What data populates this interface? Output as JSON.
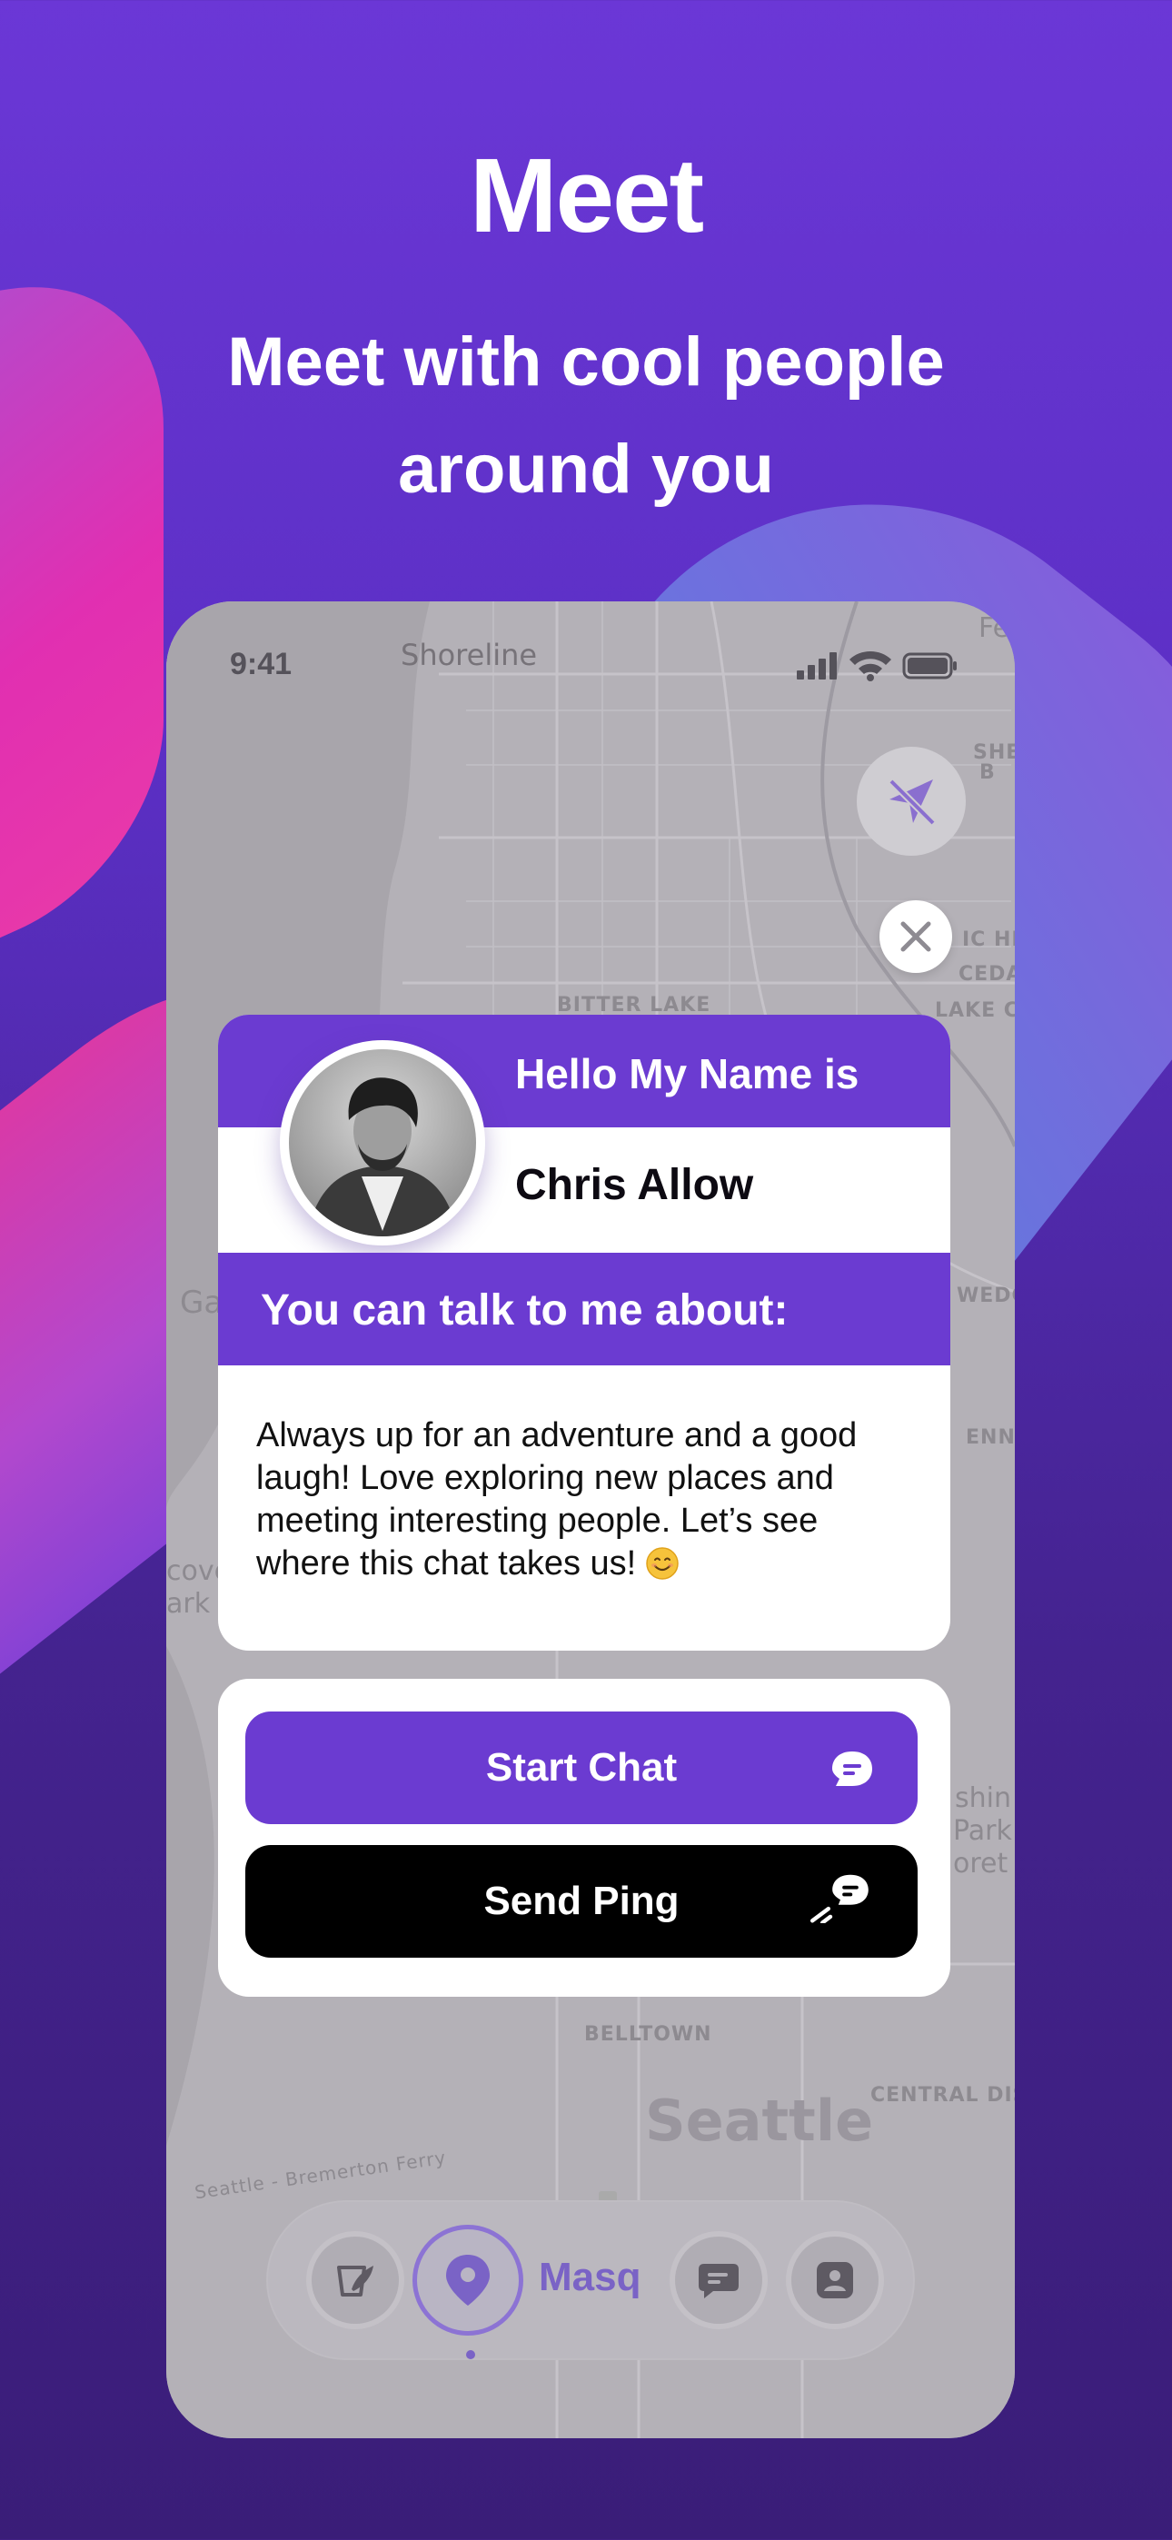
{
  "header": {
    "title": "Meet",
    "subtitle_line1": "Meet with cool people",
    "subtitle_line2": "around you"
  },
  "phone": {
    "status": {
      "time": "9:41"
    },
    "map_labels": {
      "shoreline": "Shoreline",
      "bitter_lake": "BITTER LAKE",
      "belltown": "BELLTOWN",
      "seattle": "Seattle",
      "central_dis": "CENTRAL DIS",
      "ferry": "Seattle - Bremerton Ferry",
      "she": "SHE",
      "ic_hil": "IC HIL",
      "ceda": "CEDA",
      "lake_ci": "LAKE CI",
      "wedg": "WEDG",
      "enna": "ENNA",
      "ga": "Ga",
      "cove": "cove",
      "ark": "ark",
      "shin": "shin",
      "park": "Park",
      "oret": "oret",
      "fe": "Fe",
      "b": "B"
    },
    "icons": {
      "location_off": "location-off-icon",
      "close": "close-icon",
      "signal": "cellular-signal-icon",
      "wifi": "wifi-icon",
      "battery": "battery-icon"
    },
    "profile_card": {
      "greeting": "Hello My Name is",
      "name": "Chris Allow",
      "topics_label": "You can talk to me about:",
      "bio": "Always up for an adventure and a good laugh! Love exploring new places and meeting interesting people. Let’s see where this chat takes us!"
    },
    "actions": {
      "start_chat": "Start Chat",
      "send_ping": "Send Ping"
    },
    "bottom_nav": {
      "brand": "Masq",
      "items": [
        "feed-icon",
        "map-pin-icon",
        "chat-icon",
        "profile-icon"
      ]
    }
  },
  "colors": {
    "accent": "#6b3bd1",
    "background_top": "#6b37d6",
    "background_bottom": "#3a1d78",
    "ping_button": "#000000"
  }
}
